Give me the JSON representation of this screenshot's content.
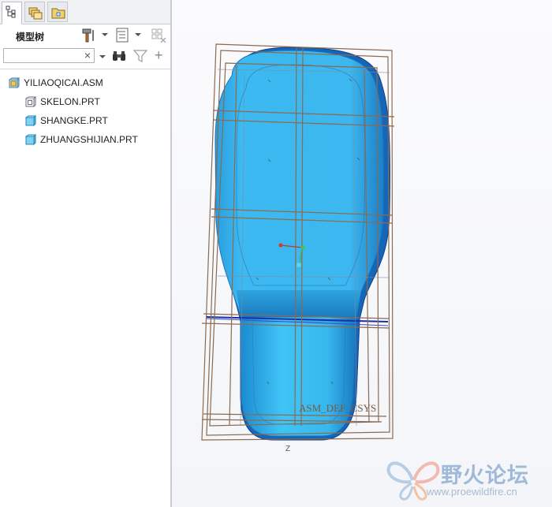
{
  "left_panel": {
    "tabs": [
      {
        "name": "model-tree-tab",
        "icon": "model-tree-icon",
        "active": true
      },
      {
        "name": "folder-browser-tab",
        "icon": "folder-browser-icon",
        "active": false
      },
      {
        "name": "favorites-tab",
        "icon": "favorites-icon",
        "active": false
      }
    ],
    "toolbar": {
      "title": "模型树",
      "settings_icon": "hammer-icon",
      "show_icon": "list-settings-icon",
      "grid_icon": "column-grid-icon"
    },
    "search": {
      "value": "",
      "clear_icon": "×",
      "find_icon": "binoculars-icon",
      "filter_icon": "filter-icon",
      "add_icon": "+"
    },
    "tree": {
      "root": {
        "label": "YILIAOQICAI.ASM",
        "icon": "assembly-icon"
      },
      "children": [
        {
          "label": "SKELON.PRT",
          "icon": "skeleton-part-icon"
        },
        {
          "label": "SHANGKE.PRT",
          "icon": "part-icon"
        },
        {
          "label": "ZHUANGSHIJIAN.PRT",
          "icon": "part-icon"
        }
      ]
    }
  },
  "viewport": {
    "csys_label": "ASM_DEF_CSYS",
    "view_label": "Z",
    "model_color": "#33b5ee"
  },
  "watermark": {
    "title": "野火论坛",
    "url": "www.proewildfire.cn"
  }
}
